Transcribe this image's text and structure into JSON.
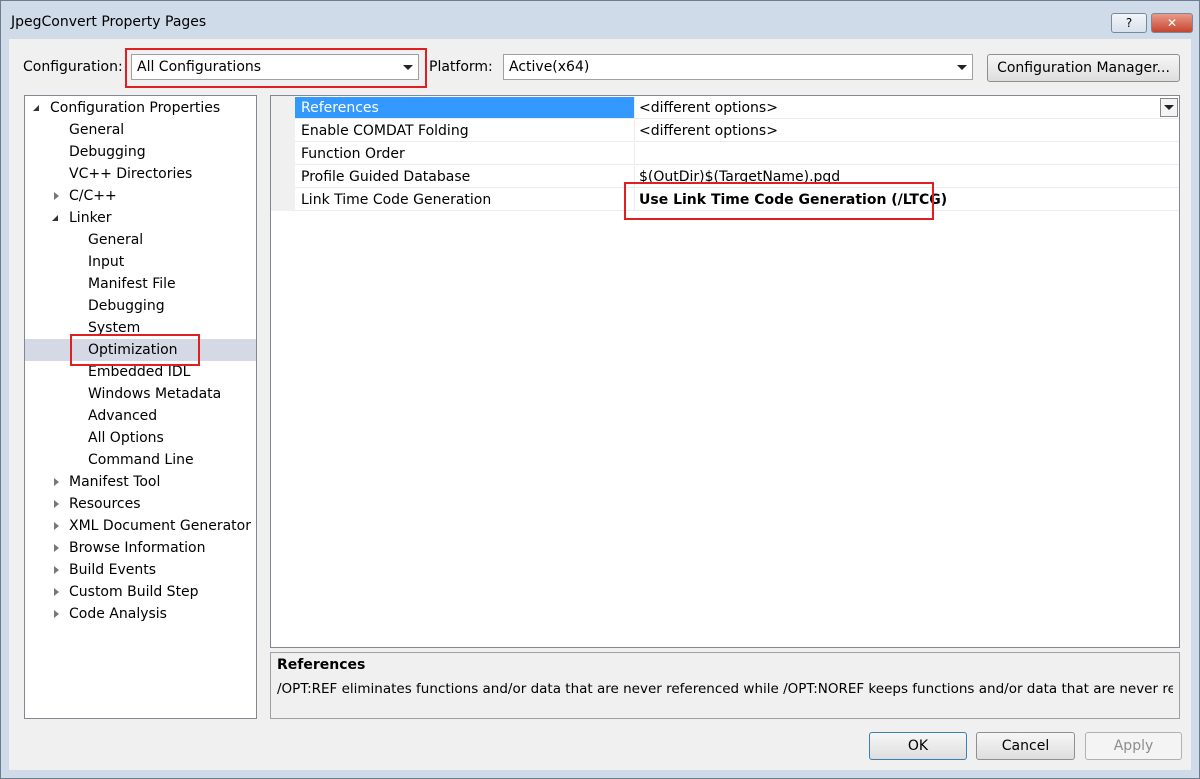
{
  "window": {
    "title": "JpegConvert Property Pages",
    "help_label": "?",
    "close_label": "✕"
  },
  "toolbar": {
    "configuration_label": "Configuration:",
    "configuration_value": "All Configurations",
    "platform_label": "Platform:",
    "platform_value": "Active(x64)",
    "config_manager_label": "Configuration Manager..."
  },
  "tree": {
    "root": "Configuration Properties",
    "items": [
      {
        "label": "General"
      },
      {
        "label": "Debugging"
      },
      {
        "label": "VC++ Directories"
      },
      {
        "label": "C/C++"
      },
      {
        "label": "Linker"
      },
      {
        "label": "General"
      },
      {
        "label": "Input"
      },
      {
        "label": "Manifest File"
      },
      {
        "label": "Debugging"
      },
      {
        "label": "System"
      },
      {
        "label": "Optimization"
      },
      {
        "label": "Embedded IDL"
      },
      {
        "label": "Windows Metadata"
      },
      {
        "label": "Advanced"
      },
      {
        "label": "All Options"
      },
      {
        "label": "Command Line"
      },
      {
        "label": "Manifest Tool"
      },
      {
        "label": "Resources"
      },
      {
        "label": "XML Document Generator"
      },
      {
        "label": "Browse Information"
      },
      {
        "label": "Build Events"
      },
      {
        "label": "Custom Build Step"
      },
      {
        "label": "Code Analysis"
      }
    ],
    "selected": "Optimization"
  },
  "grid": {
    "rows": [
      {
        "name": "References",
        "value": "<different options>"
      },
      {
        "name": "Enable COMDAT Folding",
        "value": "<different options>"
      },
      {
        "name": "Function Order",
        "value": ""
      },
      {
        "name": "Profile Guided Database",
        "value": "$(OutDir)$(TargetName).pgd"
      },
      {
        "name": "Link Time Code Generation",
        "value": "Use Link Time Code Generation (/LTCG)"
      }
    ],
    "selected": "References"
  },
  "description": {
    "title": "References",
    "text": "/OPT:REF eliminates functions and/or data that are never referenced while /OPT:NOREF keeps functions and/or data that are never ref..."
  },
  "buttons": {
    "ok": "OK",
    "cancel": "Cancel",
    "apply": "Apply"
  },
  "colors": {
    "selection": "#3399ff",
    "highlight_box": "#e02020",
    "tree_selection": "#d5d9e6"
  }
}
